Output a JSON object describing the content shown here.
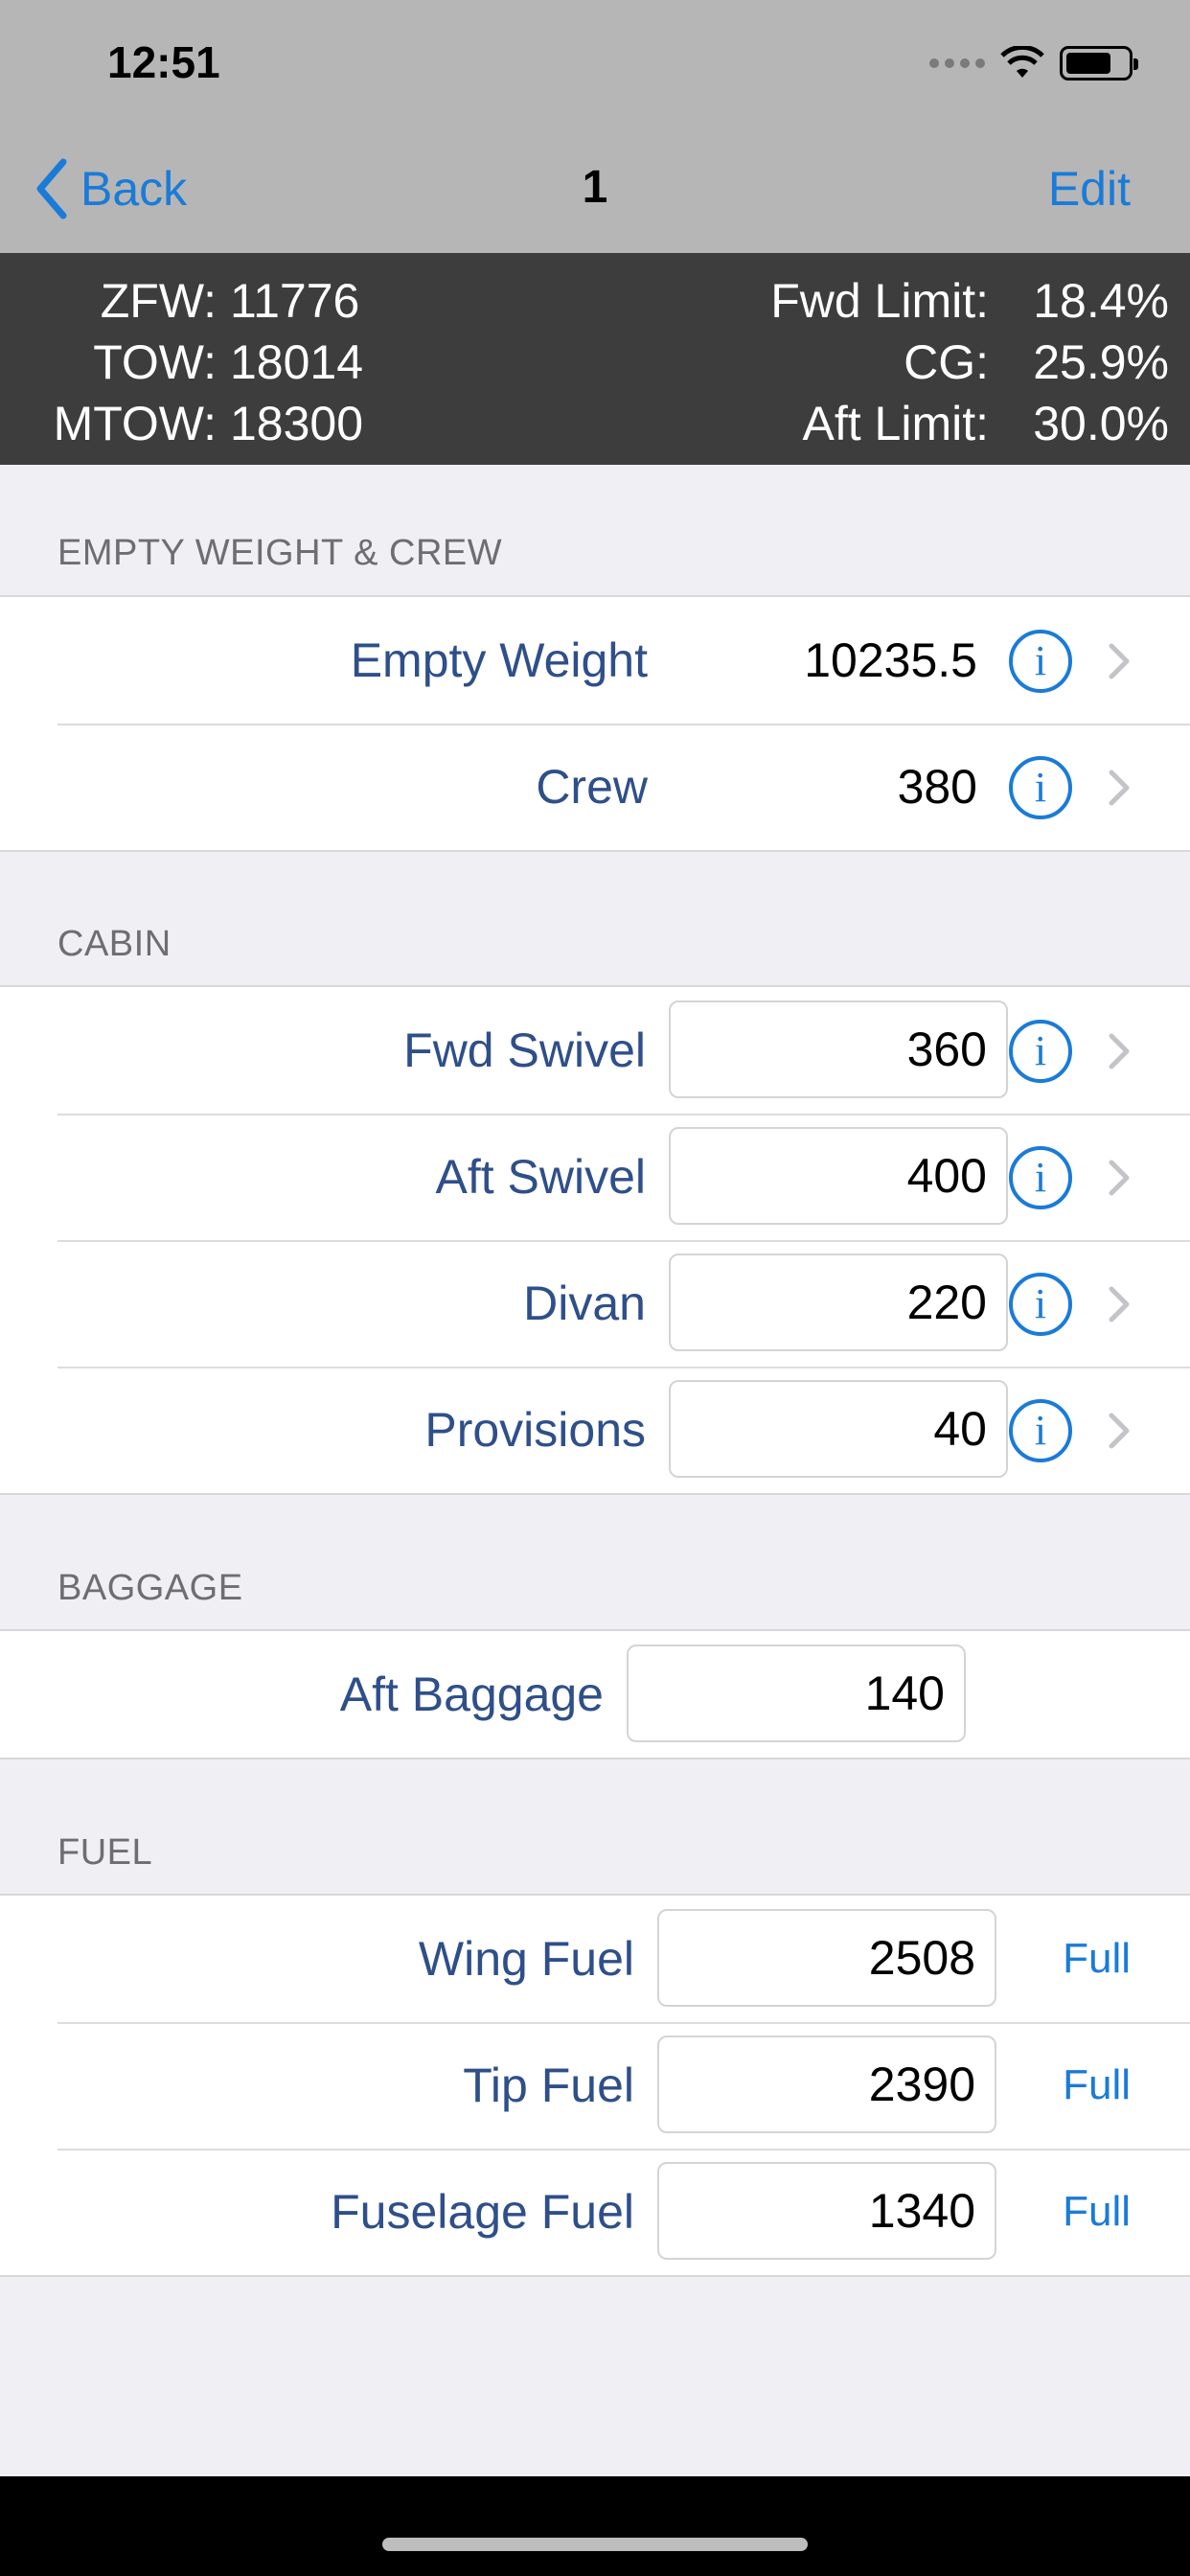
{
  "status_bar": {
    "time": "12:51"
  },
  "nav": {
    "back_label": "Back",
    "title": "1",
    "edit_label": "Edit"
  },
  "summary": {
    "zfw_label": "ZFW:",
    "zfw_value": "11776",
    "tow_label": "TOW:",
    "tow_value": "18014",
    "mtow_label": "MTOW:",
    "mtow_value": "18300",
    "fwd_limit_label": "Fwd Limit:",
    "fwd_limit_value": "18.4%",
    "cg_label": "CG:",
    "cg_value": "25.9%",
    "aft_limit_label": "Aft Limit:",
    "aft_limit_value": "30.0%"
  },
  "sections": {
    "empty_weight_crew": {
      "header": "EMPTY WEIGHT & CREW",
      "rows": [
        {
          "label": "Empty Weight",
          "value": "10235.5"
        },
        {
          "label": "Crew",
          "value": "380"
        }
      ]
    },
    "cabin": {
      "header": "CABIN",
      "rows": [
        {
          "label": "Fwd Swivel",
          "value": "360"
        },
        {
          "label": "Aft Swivel",
          "value": "400"
        },
        {
          "label": "Divan",
          "value": "220"
        },
        {
          "label": "Provisions",
          "value": "40"
        }
      ]
    },
    "baggage": {
      "header": "BAGGAGE",
      "rows": [
        {
          "label": "Aft Baggage",
          "value": "140"
        }
      ]
    },
    "fuel": {
      "header": "FUEL",
      "full_label": "Full",
      "rows": [
        {
          "label": "Wing Fuel",
          "value": "2508"
        },
        {
          "label": "Tip Fuel",
          "value": "2390"
        },
        {
          "label": "Fuselage Fuel",
          "value": "1340"
        }
      ]
    }
  },
  "icons": {
    "info": "info-icon",
    "chevron": "chevron-right-icon",
    "back": "chevron-left-icon"
  },
  "colors": {
    "accent": "#1a7bd8",
    "label": "#2f4f8a",
    "summary_bg": "#3d3d3d",
    "nav_bg": "#b6b6b6",
    "background": "#efeff4"
  }
}
